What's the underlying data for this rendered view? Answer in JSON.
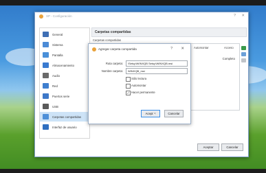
{
  "window": {
    "title": "XP - Configuración",
    "help": "?",
    "close": "✕"
  },
  "sidebar": {
    "items": [
      {
        "label": "General",
        "icon": "general-icon",
        "color": "#3f6fb5"
      },
      {
        "label": "Sistema",
        "icon": "system-icon",
        "color": "#4c8bd6"
      },
      {
        "label": "Pantalla",
        "icon": "display-icon",
        "color": "#4a90d9"
      },
      {
        "label": "Almacenamiento",
        "icon": "storage-icon",
        "color": "#3a7bd0"
      },
      {
        "label": "Audio",
        "icon": "audio-icon",
        "color": "#6a6a6a"
      },
      {
        "label": "Red",
        "icon": "network-icon",
        "color": "#3f7fcf"
      },
      {
        "label": "Puertos serie",
        "icon": "serial-ports-icon",
        "color": "#3e78c8"
      },
      {
        "label": "USB",
        "icon": "usb-icon",
        "color": "#5a5a5a"
      },
      {
        "label": "Carpetas compartidas",
        "icon": "shared-folders-icon",
        "color": "#4d8fd8",
        "selected": true
      },
      {
        "label": "Interfaz de usuario",
        "icon": "user-interface-icon",
        "color": "#2f6fc0"
      }
    ]
  },
  "page_title": "Carpetas compartidas",
  "section_label": "Carpetas compartidas",
  "table": {
    "col_automount": "Automontar",
    "col_access": "Acceso",
    "value": "Completo"
  },
  "footer": {
    "accept": "Aceptar",
    "cancel": "Cancelar"
  },
  "dialog": {
    "title": "Agregar carpeta compartida",
    "help": "?",
    "close": "✕",
    "path_label": "Ruta carpeta:",
    "path_value": "\\Setup\\WINXQB Setup\\WINXQB.msi",
    "name_label": "Nombre carpeta:",
    "name_value": "WINXQB_msi",
    "readonly_label": "Sólo lectura",
    "readonly_checked": false,
    "automount_label": "Automontar",
    "automount_checked": false,
    "permanent_label": "Hacer permanente",
    "permanent_checked": true,
    "accept": "Aceptar",
    "cancel": "Cancelar"
  },
  "colors": {
    "accent": "#3a8ee6",
    "selected_bg": "#cde3f7"
  }
}
